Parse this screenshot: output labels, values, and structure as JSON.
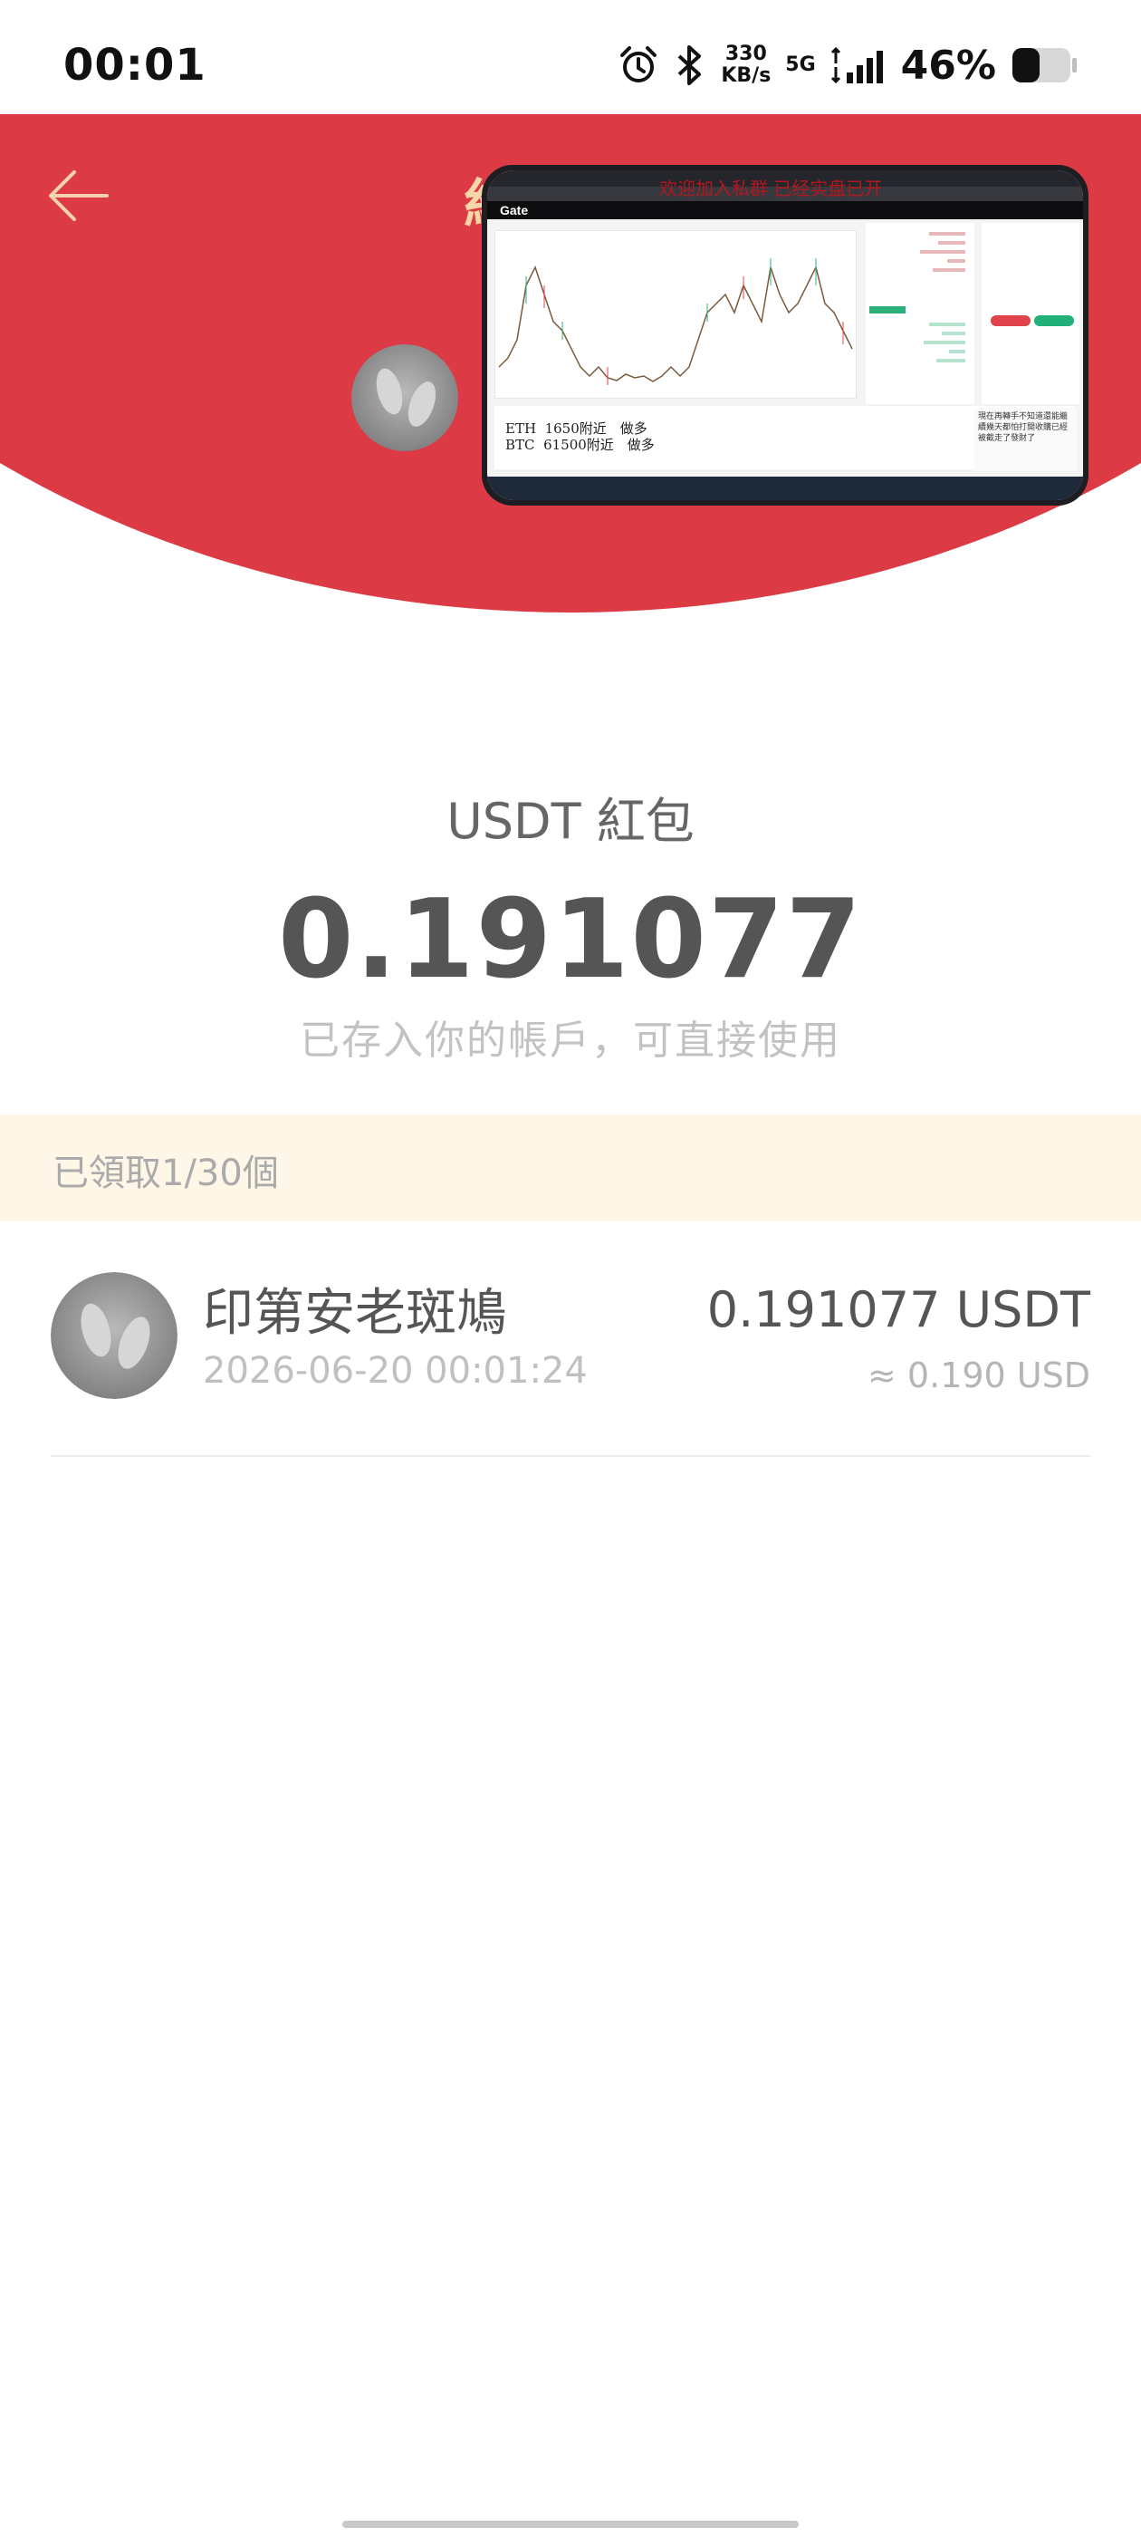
{
  "status_bar": {
    "time": "00:01",
    "net_speed_value": "330",
    "net_speed_unit": "KB/s",
    "network_type": "5G",
    "battery_percent": "46%",
    "battery_level": 0.46,
    "icons": [
      "alarm-icon",
      "bluetooth-icon",
      "signal-icon",
      "battery-icon"
    ]
  },
  "header": {
    "back_icon": "arrow-left-icon",
    "title_fragment": "紅",
    "color": "#dc3b45",
    "cover": {
      "brand": "Gate",
      "overlay_text": "欢迎加入私群 已经实盘已开",
      "notes": [
        {
          "coin": "ETH",
          "text": "1650附近　做多"
        },
        {
          "coin": "BTC",
          "text": "61500附近　做多"
        }
      ],
      "chat_text": "現在再轉手不知道還能繼續幾天都怕打開收購已經被截走了發財了"
    }
  },
  "red_packet": {
    "title": "USDT 紅包",
    "amount": "0.191077",
    "subtitle": "已存入你的帳戶，可直接使用"
  },
  "claim_status": "已領取1/30個",
  "records": [
    {
      "name": "印第安老斑鳩",
      "time": "2026-06-20 00:01:24",
      "amount": "0.191077 USDT",
      "usd": "≈ 0.190 USD"
    }
  ]
}
